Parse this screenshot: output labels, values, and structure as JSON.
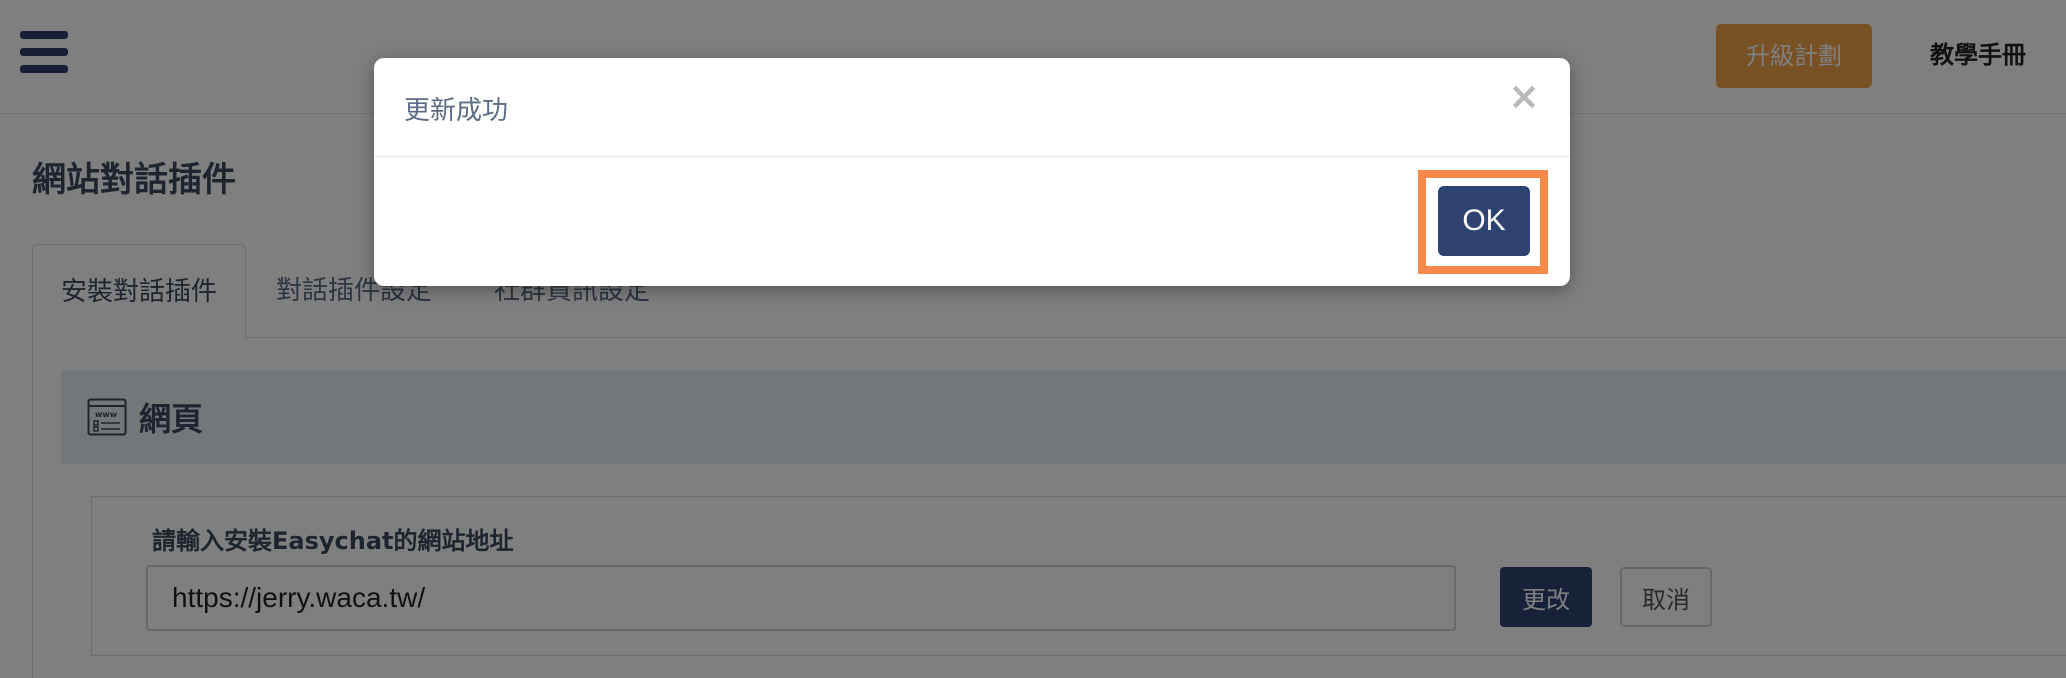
{
  "header": {
    "menu_icon": "hamburger-icon",
    "upgrade_label": "升級計劃",
    "manual_label": "教學手冊"
  },
  "page": {
    "title": "網站對話插件"
  },
  "tabs": [
    {
      "label": "安裝對話插件",
      "active": true
    },
    {
      "label": "對話插件設定",
      "active": false
    },
    {
      "label": "社群資訊設定",
      "active": false
    }
  ],
  "section": {
    "icon": "www-icon",
    "title": "網頁"
  },
  "form": {
    "label": "請輸入安裝Easychat的網站地址",
    "url_value": "https://jerry.waca.tw/",
    "change_label": "更改",
    "cancel_label": "取消"
  },
  "modal": {
    "title": "更新成功",
    "close_icon": "close-icon",
    "ok_label": "OK"
  },
  "colors": {
    "primary": "#2f4372",
    "upgrade": "#f0a24a",
    "highlight": "#f7894a",
    "overlay": "rgba(0,0,0,0.5)"
  }
}
